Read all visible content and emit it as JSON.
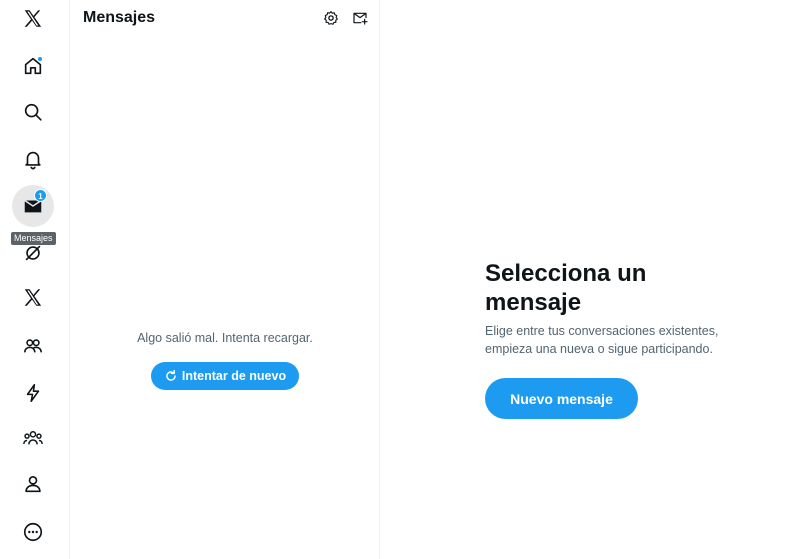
{
  "nav": {
    "items": [
      {
        "id": "logo",
        "icon": "x-logo-icon"
      },
      {
        "id": "home",
        "icon": "home-icon",
        "has_dot": true
      },
      {
        "id": "explore",
        "icon": "search-icon"
      },
      {
        "id": "notifications",
        "icon": "bell-icon"
      },
      {
        "id": "messages",
        "icon": "envelope-icon",
        "badge": "1",
        "active": true
      },
      {
        "id": "grok",
        "icon": "grok-icon"
      },
      {
        "id": "premium",
        "icon": "x-logo-icon"
      },
      {
        "id": "communities",
        "icon": "people-icon"
      },
      {
        "id": "verified-orgs",
        "icon": "lightning-icon"
      },
      {
        "id": "groups",
        "icon": "group-icon"
      },
      {
        "id": "profile",
        "icon": "person-icon"
      },
      {
        "id": "more",
        "icon": "more-circle-icon"
      }
    ],
    "tooltip": "Mensajes"
  },
  "messages": {
    "title": "Mensajes",
    "error_text": "Algo salió mal. Intenta recargar.",
    "retry_label": "Intentar de nuevo"
  },
  "detail": {
    "title": "Selecciona un mensaje",
    "subtitle": "Elige entre tus conversaciones existentes, empieza una nueva o sigue participando.",
    "button_label": "Nuevo mensaje"
  },
  "colors": {
    "accent": "#1d9bf0",
    "text_primary": "#0f1419",
    "text_secondary": "#536471",
    "border": "#eff3f4"
  }
}
